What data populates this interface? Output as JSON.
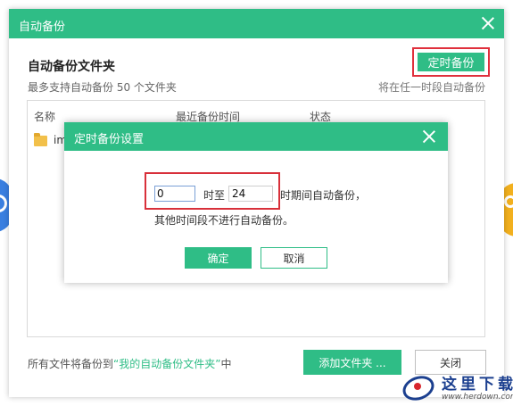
{
  "window": {
    "title": "自动备份",
    "section_title": "自动备份文件夹",
    "section_subtitle": "最多支持自动备份 50 个文件夹",
    "timed_backup_button": "定时备份",
    "timed_hint": "将在任一时段自动备份"
  },
  "list": {
    "columns": [
      "名称",
      "最近备份时间",
      "状态"
    ],
    "rows": [
      {
        "name": "im",
        "time": "",
        "status": ""
      }
    ]
  },
  "footer": {
    "prefix": "所有文件将备份到",
    "target": "“我的自动备份文件夹”",
    "suffix": "中",
    "add_folder_button": "添加文件夹 ...",
    "close_button": "关闭"
  },
  "modal": {
    "title": "定时备份设置",
    "start_value": "0",
    "to_label": "时至",
    "end_value": "24",
    "suffix_label": "时期间自动备份，",
    "note": "其他时间段不进行自动备份。",
    "ok_button": "确定",
    "cancel_button": "取消"
  },
  "watermark": {
    "text": "这里下载",
    "url": "www.herdown.com"
  },
  "colors": {
    "accent": "#2fbd86",
    "highlight_border": "#e0303c"
  }
}
